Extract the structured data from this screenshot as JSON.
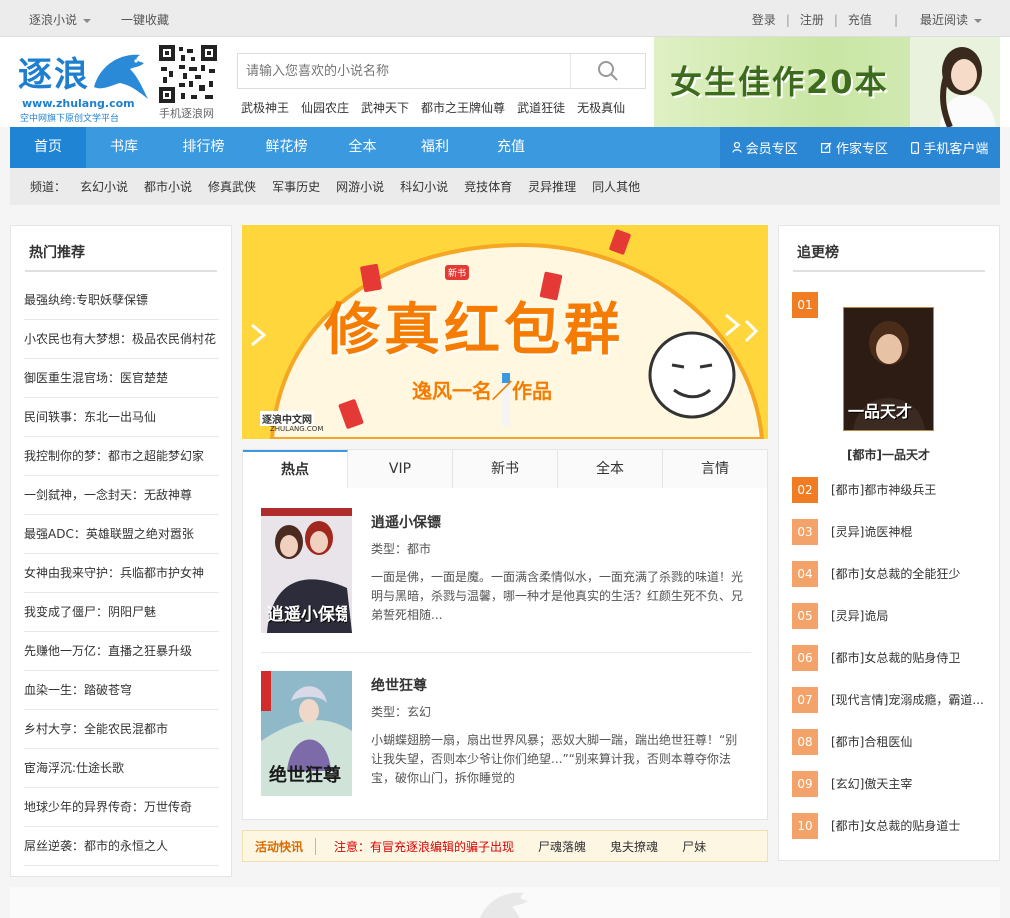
{
  "topbar": {
    "site_menu": "逐浪小说",
    "bookmark": "一键收藏",
    "login": "登录",
    "register": "注册",
    "recharge": "充值",
    "recent": "最近阅读"
  },
  "header": {
    "logo_text": "逐浪",
    "logo_url": "www.zhulang.com",
    "logo_slogan": "空中网旗下原创文学平台",
    "qr_label": "手机逐浪网",
    "search_placeholder": "请输入您喜欢的小说名称",
    "hotwords": [
      "武极神王",
      "仙园农庄",
      "武神天下",
      "都市之王牌仙尊",
      "武道狂徒",
      "无极真仙"
    ],
    "banner_text": "女生佳作20本"
  },
  "nav": {
    "items": [
      "首页",
      "书库",
      "排行榜",
      "鲜花榜",
      "全本",
      "福利",
      "充值"
    ],
    "right": [
      "会员专区",
      "作家专区",
      "手机客户端"
    ]
  },
  "channel": {
    "label": "频道：",
    "items": [
      "玄幻小说",
      "都市小说",
      "修真武侠",
      "军事历史",
      "网游小说",
      "科幻小说",
      "竞技体育",
      "灵异推理",
      "同人其他"
    ]
  },
  "left_panel": {
    "title": "热门推荐",
    "items": [
      "最强纨绔:专职妖孽保镖",
      "小农民也有大梦想：极品农民俏村花",
      "御医重生混官场：医官楚楚",
      "民间轶事：东北一出马仙",
      "我控制你的梦：都市之超能梦幻家",
      "一剑弑神，一念封天：无敌神尊",
      "最强ADC：英雄联盟之绝对嚣张",
      "女神由我来守护：兵临都市护女神",
      "我变成了僵尸：阴阳尸魅",
      "先赚他一万亿：直播之狂暴升级",
      "血染一生：踏破苍穹",
      "乡村大亨：全能农民混都市",
      "宦海浮沉:仕途长歌",
      "地球少年的异界传奇：万世传奇",
      "屌丝逆袭：都市的永恒之人"
    ]
  },
  "slider": {
    "title": "修真红包群",
    "subtitle": "逸风一名／作品",
    "brand": "逐浪中文网",
    "brand_url": "ZHULANG.COM",
    "tag": "新书"
  },
  "tabs": [
    "热点",
    "VIP",
    "新书",
    "全本",
    "言情"
  ],
  "books": [
    {
      "title": "逍遥小保镖",
      "type": "类型：都市",
      "desc": "一面是佛，一面是魔。一面满含柔情似水，一面充满了杀戮的味道！光明与黑暗，杀戮与温馨，哪一种才是他真实的生活？红颜生死不负、兄弟誓死相随...",
      "cover_text": "逍遥小保镖"
    },
    {
      "title": "绝世狂尊",
      "type": "类型：玄幻",
      "desc": "小蝴蝶翅膀一扇，扇出世界风暴；恶奴大脚一踹，踹出绝世狂尊！“别让我失望，否则本少爷让你们绝望...”“别来算计我，否则本尊夺你法宝，破你山门，拆你睡觉的",
      "cover_text": "绝世狂尊"
    }
  ],
  "news": {
    "label": "活动快讯",
    "items": [
      "注意：有冒充逐浪编辑的骗子出现",
      "尸魂落魄",
      "鬼夫撩魂",
      "尸妹"
    ]
  },
  "right_panel": {
    "title": "追更榜",
    "top": {
      "num": "01",
      "title": "[都市]一品天才",
      "cover_text": "一品天才"
    },
    "items": [
      {
        "num": "02",
        "title": "[都市]都市神级兵王"
      },
      {
        "num": "03",
        "title": "[灵异]诡医神棍"
      },
      {
        "num": "04",
        "title": "[都市]女总裁的全能狂少"
      },
      {
        "num": "05",
        "title": "[灵异]诡局"
      },
      {
        "num": "06",
        "title": "[都市]女总裁的贴身侍卫"
      },
      {
        "num": "07",
        "title": "[现代言情]宠溺成瘾，霸道..."
      },
      {
        "num": "08",
        "title": "[都市]合租医仙"
      },
      {
        "num": "09",
        "title": "[玄幻]傲天主宰"
      },
      {
        "num": "10",
        "title": "[都市]女总裁的贴身道士"
      }
    ]
  },
  "colors": {
    "nav_blue": "#3b99e0",
    "rank_orange": "#f07c23",
    "rank_light": "#f3a36a",
    "news_red": "#dd0000"
  }
}
